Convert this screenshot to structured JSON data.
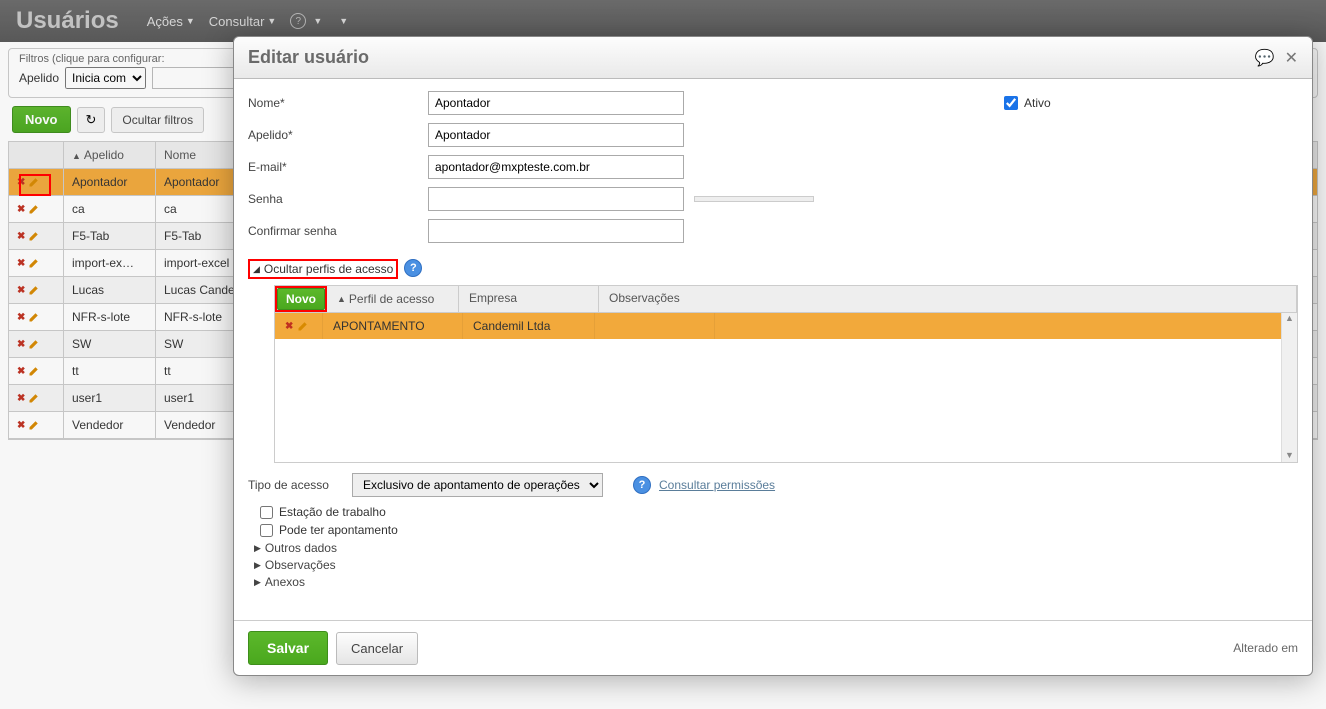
{
  "topbar": {
    "title": "Usuários",
    "menus": [
      "Ações",
      "Consultar"
    ]
  },
  "filters": {
    "label": "Filtros (clique para configurar:",
    "field_label": "Apelido",
    "operator": "Inicia com",
    "value": ""
  },
  "actionbar": {
    "novo": "Novo",
    "ocultar": "Ocultar filtros"
  },
  "grid": {
    "headers": {
      "apelido": "Apelido",
      "nome": "Nome"
    },
    "rows": [
      {
        "apelido": "Apontador",
        "nome": "Apontador",
        "highlighted": true
      },
      {
        "apelido": "ca",
        "nome": "ca"
      },
      {
        "apelido": "F5-Tab",
        "nome": "F5-Tab"
      },
      {
        "apelido": "import-ex…",
        "nome": "import-excel"
      },
      {
        "apelido": "Lucas",
        "nome": "Lucas Candemil"
      },
      {
        "apelido": "NFR-s-lote",
        "nome": "NFR-s-lote"
      },
      {
        "apelido": "SW",
        "nome": "SW"
      },
      {
        "apelido": "tt",
        "nome": "tt"
      },
      {
        "apelido": "user1",
        "nome": "user1"
      },
      {
        "apelido": "Vendedor",
        "nome": "Vendedor"
      }
    ]
  },
  "modal": {
    "title": "Editar usuário",
    "labels": {
      "nome": "Nome*",
      "apelido": "Apelido*",
      "email": "E-mail*",
      "senha": "Senha",
      "confirmar": "Confirmar senha",
      "ativo": "Ativo",
      "ocultar_perfis": "Ocultar perfis de acesso",
      "tipo_acesso": "Tipo de acesso",
      "consultar_perm": "Consultar permissões",
      "estacao": "Estação de trabalho",
      "pode_apont": "Pode ter apontamento",
      "outros": "Outros dados",
      "obs": "Observações",
      "anexos": "Anexos"
    },
    "values": {
      "nome": "Apontador",
      "apelido": "Apontador",
      "email": "apontador@mxpteste.com.br",
      "ativo_checked": true,
      "tipo_acesso": "Exclusivo de apontamento de operações",
      "estacao_checked": false,
      "pode_apont_checked": false
    },
    "inner_grid": {
      "novo": "Novo",
      "headers": {
        "perfil": "Perfil de acesso",
        "empresa": "Empresa",
        "obs": "Observações"
      },
      "row": {
        "perfil": "APONTAMENTO",
        "empresa": "Candemil Ltda",
        "obs": ""
      }
    },
    "footer": {
      "salvar": "Salvar",
      "cancelar": "Cancelar",
      "alterado": "Alterado em"
    }
  }
}
